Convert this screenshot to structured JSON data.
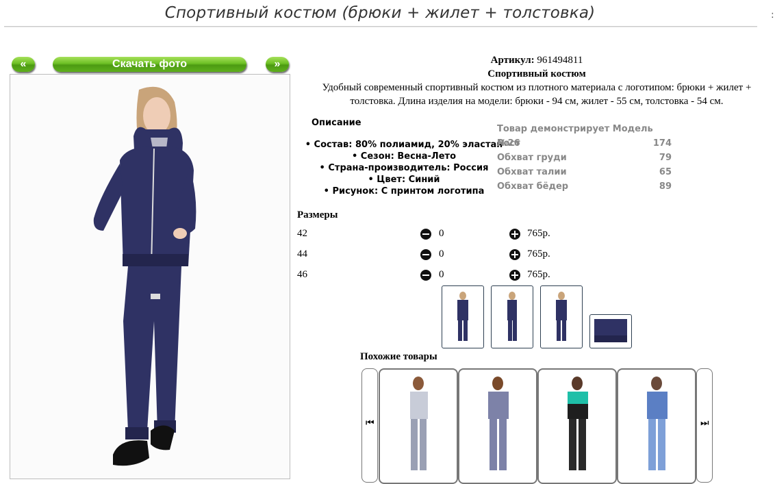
{
  "title": "Спортивный костюм (брюки + жилет + толстовка)",
  "corner_mark": ":",
  "nav": {
    "prev": "«",
    "download": "Скачать фото",
    "next": "»"
  },
  "product": {
    "article_label": "Артикул:",
    "article_value": "961494811",
    "name": "Спортивный костюм",
    "description": "Удобный современный спортивный костюм из плотного материала с логотипом: брюки + жилет + толстовка. Длина изделия на модели: брюки - 94 см, жилет - 55 см, толстовка - 54 см.",
    "desc_title": "Описание",
    "features": [
      "• Состав: 80% полиамид, 20% эластан",
      "• Сезон: Весна-Лето",
      "• Страна-производитель: Россия",
      "• Цвет: Синий",
      "• Рисунок: С принтом логотипа"
    ]
  },
  "model": {
    "header": "Товар демонстрирует Модель №26",
    "rows": [
      {
        "label": "Рост",
        "value": "174"
      },
      {
        "label": "Обхват груди",
        "value": "79"
      },
      {
        "label": "Обхват талии",
        "value": "65"
      },
      {
        "label": "Обхват бёдер",
        "value": "89"
      }
    ]
  },
  "sizes": {
    "title": "Размеры",
    "rows": [
      {
        "size": "42",
        "qty": "0",
        "price": "765р."
      },
      {
        "size": "44",
        "qty": "0",
        "price": "765р."
      },
      {
        "size": "46",
        "qty": "0",
        "price": "765р."
      }
    ]
  },
  "similar_title": "Похожие товары",
  "colors": {
    "suit": "#2f3264",
    "suit_light": "#4a4d86",
    "green": "#5fb01c",
    "teal": "#1fbfa8"
  }
}
